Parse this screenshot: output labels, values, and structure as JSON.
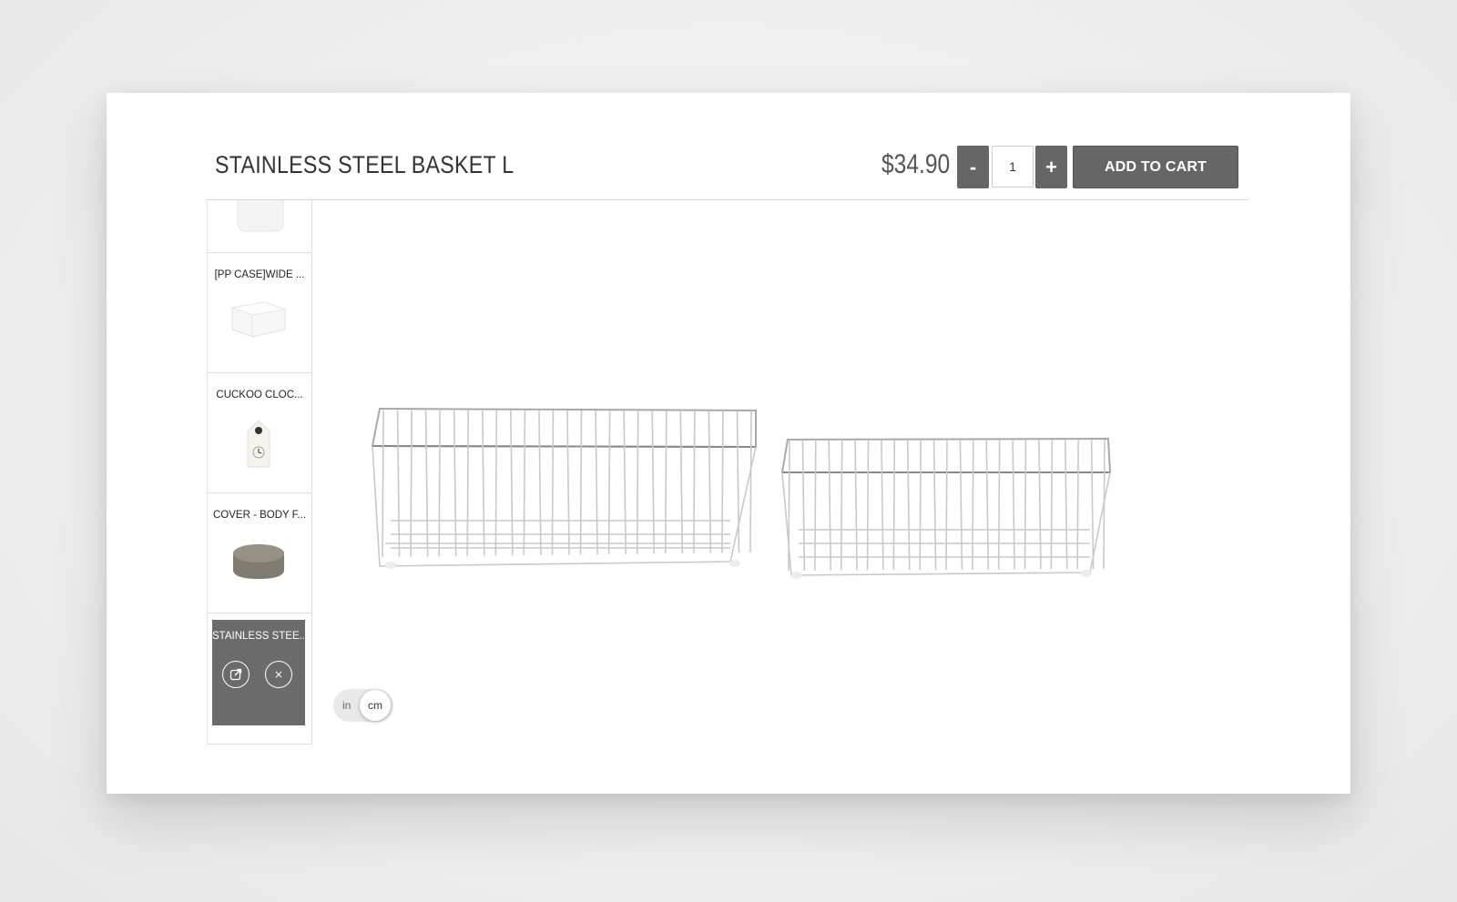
{
  "product": {
    "title": "STAINLESS STEEL BASKET L",
    "price": "$34.90",
    "quantity": "1",
    "minus_label": "-",
    "plus_label": "+",
    "add_to_cart_label": "ADD TO CART"
  },
  "sidebar": {
    "items": [
      {
        "label": "",
        "icon": "white-jar-thumbnail"
      },
      {
        "label": "[PP CASE]WIDE ...",
        "icon": "white-box-thumbnail"
      },
      {
        "label": "CUCKOO CLOC...",
        "icon": "cuckoo-clock-thumbnail"
      },
      {
        "label": "COVER - BODY F...",
        "icon": "cushion-cover-thumbnail"
      },
      {
        "label": "STAINLESS STEE...",
        "icon": "active-item",
        "active": true
      }
    ],
    "open_icon": "external-link-icon",
    "remove_label": "×"
  },
  "unit_toggle": {
    "left": "in",
    "right": "cm",
    "selected": "cm"
  },
  "colors": {
    "button_bg": "#666666",
    "active_item_bg": "#6b6b6b"
  }
}
